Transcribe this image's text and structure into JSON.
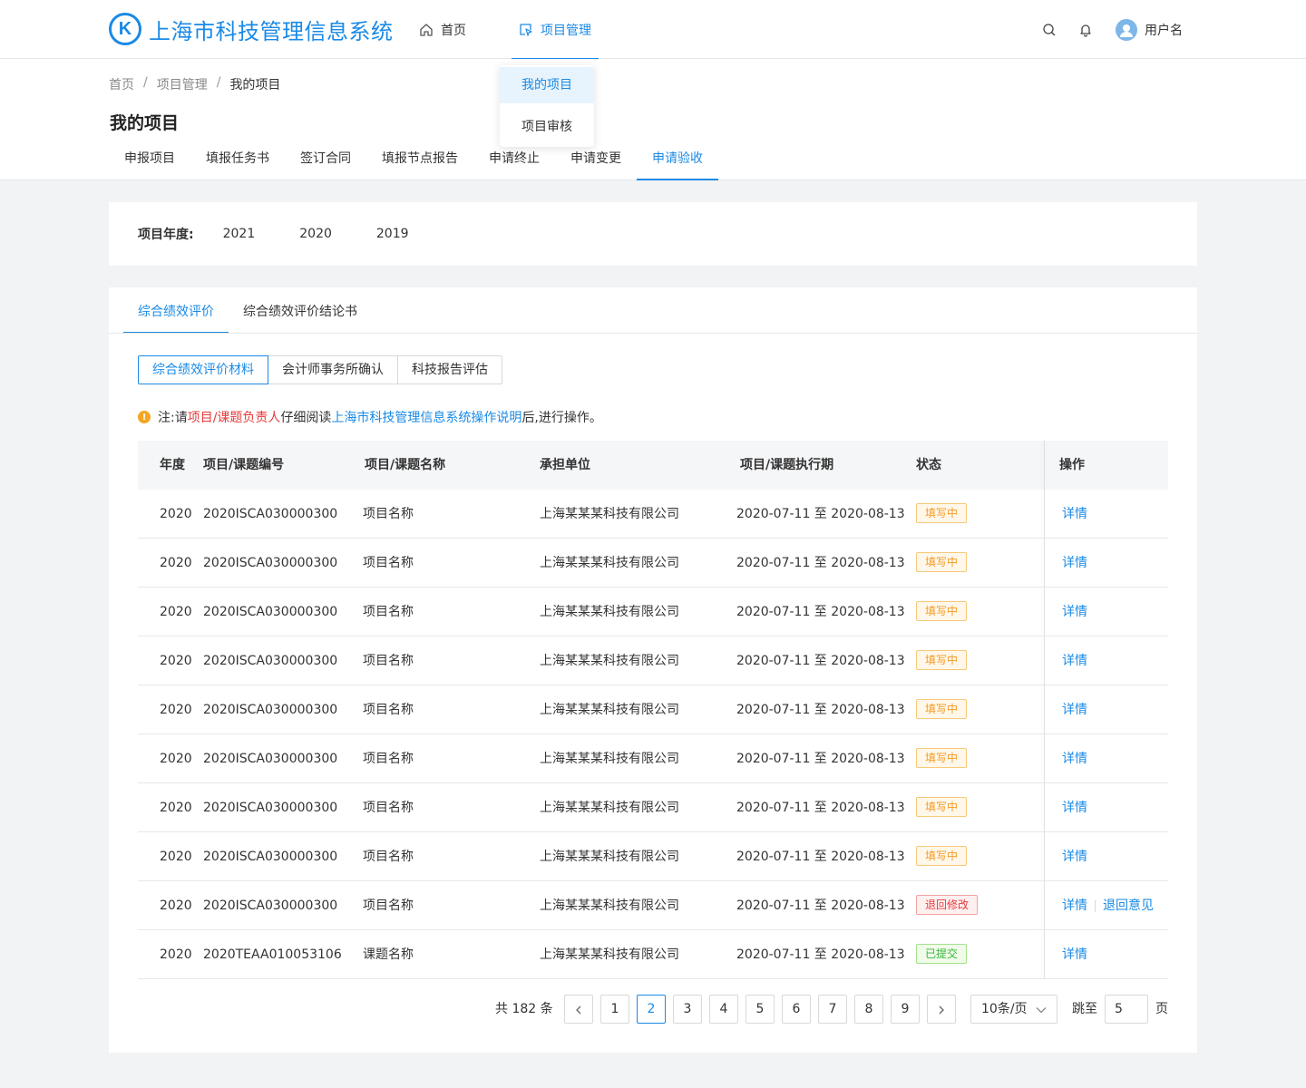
{
  "header": {
    "logo_letter": "K",
    "app_title": "上海市科技管理信息系统",
    "nav": {
      "home": "首页",
      "project_mgmt": "项目管理"
    },
    "username": "用户名"
  },
  "dropdown": {
    "items": [
      "我的项目",
      "项目审核"
    ],
    "active": "我的项目"
  },
  "breadcrumb": [
    "首页",
    "项目管理",
    "我的项目"
  ],
  "page_title": "我的项目",
  "tabs": [
    "申报项目",
    "填报任务书",
    "签订合同",
    "填报节点报告",
    "申请终止",
    "申请变更",
    "申请验收"
  ],
  "active_tab": "申请验收",
  "year_filter": {
    "label": "项目年度:",
    "options": [
      "2021",
      "2020",
      "2019"
    ]
  },
  "subtabs": [
    "综合绩效评价",
    "综合绩效评价结论书"
  ],
  "active_subtab": "综合绩效评价",
  "segments": [
    "综合绩效评价材料",
    "会计师事务所确认",
    "科技报告评估"
  ],
  "active_segment": "综合绩效评价材料",
  "notice": {
    "prefix": "注:请",
    "red": "项目/课题负责人",
    "mid": "仔细阅读",
    "link": "上海市科技管理信息系统操作说明",
    "suffix": "后,进行操作。"
  },
  "table": {
    "columns": [
      "年度",
      "项目/课题编号",
      "项目/课题名称",
      "承担单位",
      "项目/课题执行期",
      "状态",
      "操作"
    ],
    "rows": [
      {
        "year": "2020",
        "code": "2020ISCA030000300",
        "name": "项目名称",
        "unit": "上海某某某科技有限公司",
        "period": "2020-07-11 至 2020-08-13",
        "status": "填写中",
        "status_type": "filling",
        "ops": [
          "详情"
        ]
      },
      {
        "year": "2020",
        "code": "2020ISCA030000300",
        "name": "项目名称",
        "unit": "上海某某某科技有限公司",
        "period": "2020-07-11 至 2020-08-13",
        "status": "填写中",
        "status_type": "filling",
        "ops": [
          "详情"
        ]
      },
      {
        "year": "2020",
        "code": "2020ISCA030000300",
        "name": "项目名称",
        "unit": "上海某某某科技有限公司",
        "period": "2020-07-11 至 2020-08-13",
        "status": "填写中",
        "status_type": "filling",
        "ops": [
          "详情"
        ]
      },
      {
        "year": "2020",
        "code": "2020ISCA030000300",
        "name": "项目名称",
        "unit": "上海某某某科技有限公司",
        "period": "2020-07-11 至 2020-08-13",
        "status": "填写中",
        "status_type": "filling",
        "ops": [
          "详情"
        ]
      },
      {
        "year": "2020",
        "code": "2020ISCA030000300",
        "name": "项目名称",
        "unit": "上海某某某科技有限公司",
        "period": "2020-07-11 至 2020-08-13",
        "status": "填写中",
        "status_type": "filling",
        "ops": [
          "详情"
        ]
      },
      {
        "year": "2020",
        "code": "2020ISCA030000300",
        "name": "项目名称",
        "unit": "上海某某某科技有限公司",
        "period": "2020-07-11 至 2020-08-13",
        "status": "填写中",
        "status_type": "filling",
        "ops": [
          "详情"
        ]
      },
      {
        "year": "2020",
        "code": "2020ISCA030000300",
        "name": "项目名称",
        "unit": "上海某某某科技有限公司",
        "period": "2020-07-11 至 2020-08-13",
        "status": "填写中",
        "status_type": "filling",
        "ops": [
          "详情"
        ]
      },
      {
        "year": "2020",
        "code": "2020ISCA030000300",
        "name": "项目名称",
        "unit": "上海某某某科技有限公司",
        "period": "2020-07-11 至 2020-08-13",
        "status": "填写中",
        "status_type": "filling",
        "ops": [
          "详情"
        ]
      },
      {
        "year": "2020",
        "code": "2020ISCA030000300",
        "name": "项目名称",
        "unit": "上海某某某科技有限公司",
        "period": "2020-07-11 至 2020-08-13",
        "status": "退回修改",
        "status_type": "returned",
        "ops": [
          "详情",
          "退回意见"
        ]
      },
      {
        "year": "2020",
        "code": "2020TEAA010053106",
        "name": "课题名称",
        "unit": "上海某某某科技有限公司",
        "period": "2020-07-11 至 2020-08-13",
        "status": "已提交",
        "status_type": "submitted",
        "ops": [
          "详情"
        ]
      }
    ]
  },
  "pagination": {
    "total_text": "共 182 条",
    "pages": [
      "1",
      "2",
      "3",
      "4",
      "5",
      "6",
      "7",
      "8",
      "9"
    ],
    "current": "2",
    "page_size": "10条/页",
    "jump_label": "跳至",
    "jump_value": "5",
    "jump_unit": "页"
  },
  "colors": {
    "primary": "#1a8ae6",
    "warning": "#f59a23",
    "danger": "#e53b3b",
    "success": "#3cb53c"
  }
}
